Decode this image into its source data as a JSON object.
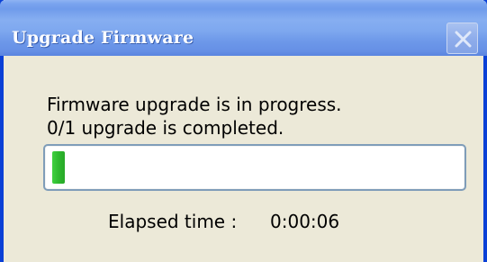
{
  "window": {
    "title": "Upgrade Firmware"
  },
  "message": {
    "line1": "Firmware upgrade is in progress.",
    "line2": "0/1 upgrade is completed."
  },
  "progress": {
    "fraction": 0.03
  },
  "elapsed": {
    "label": "Elapsed time :",
    "value": "0:00:06"
  },
  "icons": {
    "close": "close-icon"
  },
  "colors": {
    "titlebar": "#7aa4ef",
    "window_border": "#0a40d6",
    "dialog_background": "#ece9d8",
    "progress_fill": "#2fb92f",
    "progress_border": "#7f9db9"
  }
}
